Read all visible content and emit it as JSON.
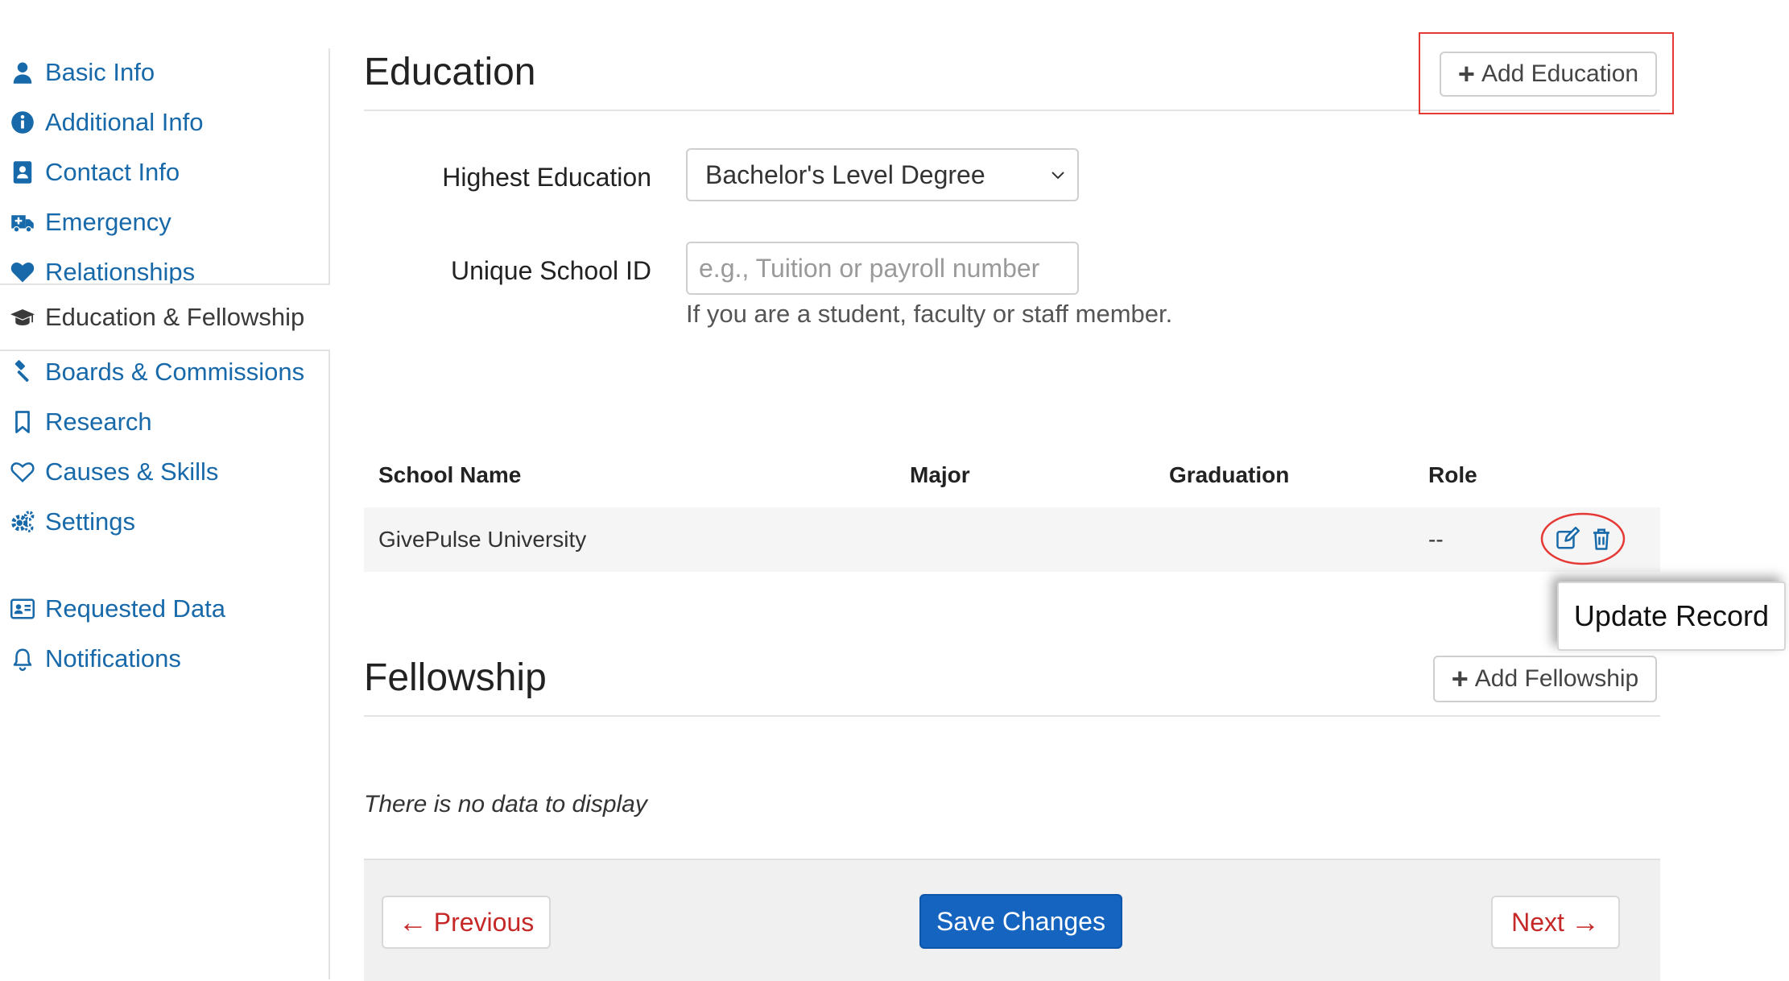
{
  "sidebar": {
    "items": [
      {
        "label": "Basic Info",
        "icon": "user-icon"
      },
      {
        "label": "Additional Info",
        "icon": "info-circle-icon"
      },
      {
        "label": "Contact Info",
        "icon": "address-book-icon"
      },
      {
        "label": "Emergency",
        "icon": "ambulance-icon"
      },
      {
        "label": "Relationships",
        "icon": "heart-icon"
      },
      {
        "label": "Education & Fellowship",
        "icon": "graduation-cap-icon"
      },
      {
        "label": "Boards & Commissions",
        "icon": "gavel-icon"
      },
      {
        "label": "Research",
        "icon": "bookmark-icon"
      },
      {
        "label": "Causes & Skills",
        "icon": "heart-outline-icon"
      },
      {
        "label": "Settings",
        "icon": "gears-icon"
      },
      {
        "label": "Requested Data",
        "icon": "id-card-icon"
      },
      {
        "label": "Notifications",
        "icon": "bell-icon"
      }
    ],
    "active_item": "Education & Fellowship"
  },
  "education": {
    "title": "Education",
    "add_button_label": "Add Education",
    "highest_education_label": "Highest Education",
    "highest_education_value": "Bachelor's Level Degree",
    "school_id_label": "Unique School ID",
    "school_id_placeholder": "e.g., Tuition or payroll number",
    "school_id_value": "",
    "school_id_help": "If you are a student, faculty or staff member.",
    "table": {
      "headers": [
        "School Name",
        "Major",
        "Graduation",
        "Role"
      ],
      "rows": [
        {
          "school_name": "GivePulse University",
          "major": "",
          "graduation": "",
          "role": "--"
        }
      ]
    },
    "tooltip": "Update Record"
  },
  "fellowship": {
    "title": "Fellowship",
    "add_button_label": "Add Fellowship",
    "empty_message": "There is no data to display"
  },
  "footer": {
    "previous_label": "Previous",
    "save_label": "Save Changes",
    "next_label": "Next"
  },
  "colors": {
    "link": "#1769aa",
    "primary": "#1565c0",
    "danger": "#c62828",
    "highlight": "#e53935"
  }
}
